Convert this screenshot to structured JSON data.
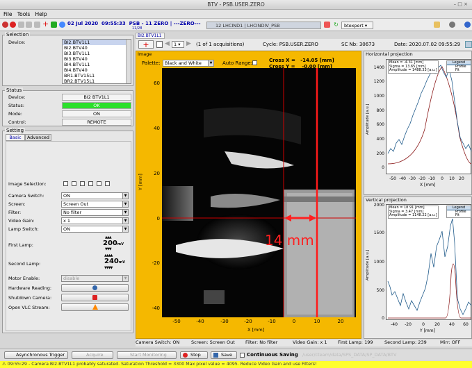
{
  "window": {
    "title": "BTV - PSB.USER.ZERO"
  },
  "menu": [
    "File",
    "Tools",
    "Help"
  ],
  "toolbar": {
    "date": "02 Jul 2020",
    "time": "09:55:33",
    "machine": "PSB",
    "cycle": "11 ZERO",
    "user": "---ZERO---",
    "sub": "11/28",
    "timing": "12 LHCIND1 | LHCINDIV_PSB",
    "rbac_user": "btexpert"
  },
  "selection": {
    "title": "Selection",
    "device_label": "Device:",
    "devices": [
      "BI2.BTV1L1",
      "BI2.BTV40",
      "BI3.BTV1L1",
      "BI3.BTV40",
      "BI4.BTV1L1",
      "BI4.BTV40",
      "BR1.BTV15L1",
      "BR2.BTV15L1"
    ]
  },
  "status": {
    "title": "Status",
    "device_label": "Device:",
    "device": "BI2 BTV1L1",
    "status_label": "Status:",
    "status": "OK",
    "mode_label": "Mode:",
    "mode": "ON",
    "control_label": "Control:",
    "control": "REMOTE"
  },
  "setting": {
    "title": "Setting",
    "tabs": [
      "Basic",
      "Advanced"
    ],
    "image_selection": "Image Selection:",
    "camera_switch": {
      "label": "Camera Switch:",
      "value": "ON"
    },
    "screen": {
      "label": "Screen:",
      "value": "Screen Out"
    },
    "filter": {
      "label": "Filter:",
      "value": "No filter"
    },
    "video_gain": {
      "label": "Video Gain:",
      "value": "x 1"
    },
    "lamp_switch": {
      "label": "Lamp Switch:",
      "value": "ON"
    },
    "first_lamp": {
      "label": "First Lamp:",
      "value": "200",
      "unit": "mV"
    },
    "second_lamp": {
      "label": "Second Lamp:",
      "value": "240",
      "unit": "mV"
    },
    "motor_enable": {
      "label": "Motor Enable:",
      "value": "disable"
    },
    "hardware_reading": "Hardware Reading:",
    "shutdown_camera": "Shutdown Camera:",
    "open_vlc": "Open VLC Stream:"
  },
  "viewer": {
    "tab": "BI2.BTV1L1",
    "acq_page": "1",
    "acq_text": "(1 of 1 acquisitions)",
    "cycle": "Cycle: PSB.USER.ZERO",
    "sc": "SC Nb: 30673",
    "date": "Date: 2020.07.02 09:55:29",
    "image_title": "Image",
    "palette_label": "Palette:",
    "palette": "Black and White",
    "auto_range": "Auto Range:",
    "cross_x": "Cross X =",
    "cross_x_val": "-14.05",
    "cross_y": "Cross Y =",
    "cross_y_val": "-0.00",
    "unit": "[mm]",
    "annotation": "14 mm",
    "y_ticks": [
      "60",
      "40",
      "20",
      "0",
      "-20",
      "-40"
    ],
    "x_ticks": [
      "-50",
      "-40",
      "-30",
      "-20",
      "-10",
      "0",
      "10",
      "20"
    ],
    "x_axis": "X [mm]",
    "y_axis": "Y [mm]"
  },
  "hproj": {
    "title": "Horizontal projection",
    "mean": "Mean = -4.31 [mm]",
    "sigma": "Sigma = 13.65 [mm]",
    "amplitude": "Amplitude = 1488.33 [a.u.]",
    "legend": "Legend",
    "profile": "Profile",
    "fit": "Fit",
    "y_ticks": [
      "1400",
      "1200",
      "1000",
      "800",
      "600",
      "400",
      "200",
      "0"
    ],
    "x_ticks": [
      "-50",
      "-40",
      "-30",
      "-20",
      "-10",
      "0",
      "10",
      "20"
    ],
    "x_axis": "X [mm]",
    "y_axis": "Amplitude [a.u.]"
  },
  "vproj": {
    "title": "Vertical projection",
    "mean": "Mean = 18.91 [mm]",
    "sigma": "Sigma = 3.47 [mm]",
    "amplitude": "Amplitude = 1148.22 [a.u.]",
    "legend": "Legend",
    "profile": "Profile",
    "fit": "Fit",
    "y_ticks": [
      "2000",
      "1500",
      "1000",
      "500",
      "0"
    ],
    "x_ticks": [
      "-40",
      "-20",
      "0",
      "20",
      "40",
      "60"
    ],
    "x_axis": "Y [mm]",
    "y_axis": "Amplitude [a.u.]"
  },
  "infobar": {
    "camera": "Camera Switch: ON",
    "screen": "Screen: Screen Out",
    "filter": "Filter: No filter",
    "gain": "Video Gain: x 1",
    "lamp1": "First Lamp: 199",
    "lamp2": "Second Lamp: 239",
    "mirr": "Mirr: OFF"
  },
  "bottom": {
    "async": "Asynchronous Trigger",
    "acquire": "Acquire",
    "start_mon": "Start Monitoring",
    "stop": "Stop",
    "save": "Save",
    "continuous": "Continuous Saving",
    "path": "/user/cteam/data/SPS_DATA/SP_DATA/BTV"
  },
  "statusline": "09:55:29 - Camera BI2.BTV1L1 probably saturated. Saturation Threshold = 3300 Max pixel value = 4095. Reduce Video Gain and use Filters!"
}
